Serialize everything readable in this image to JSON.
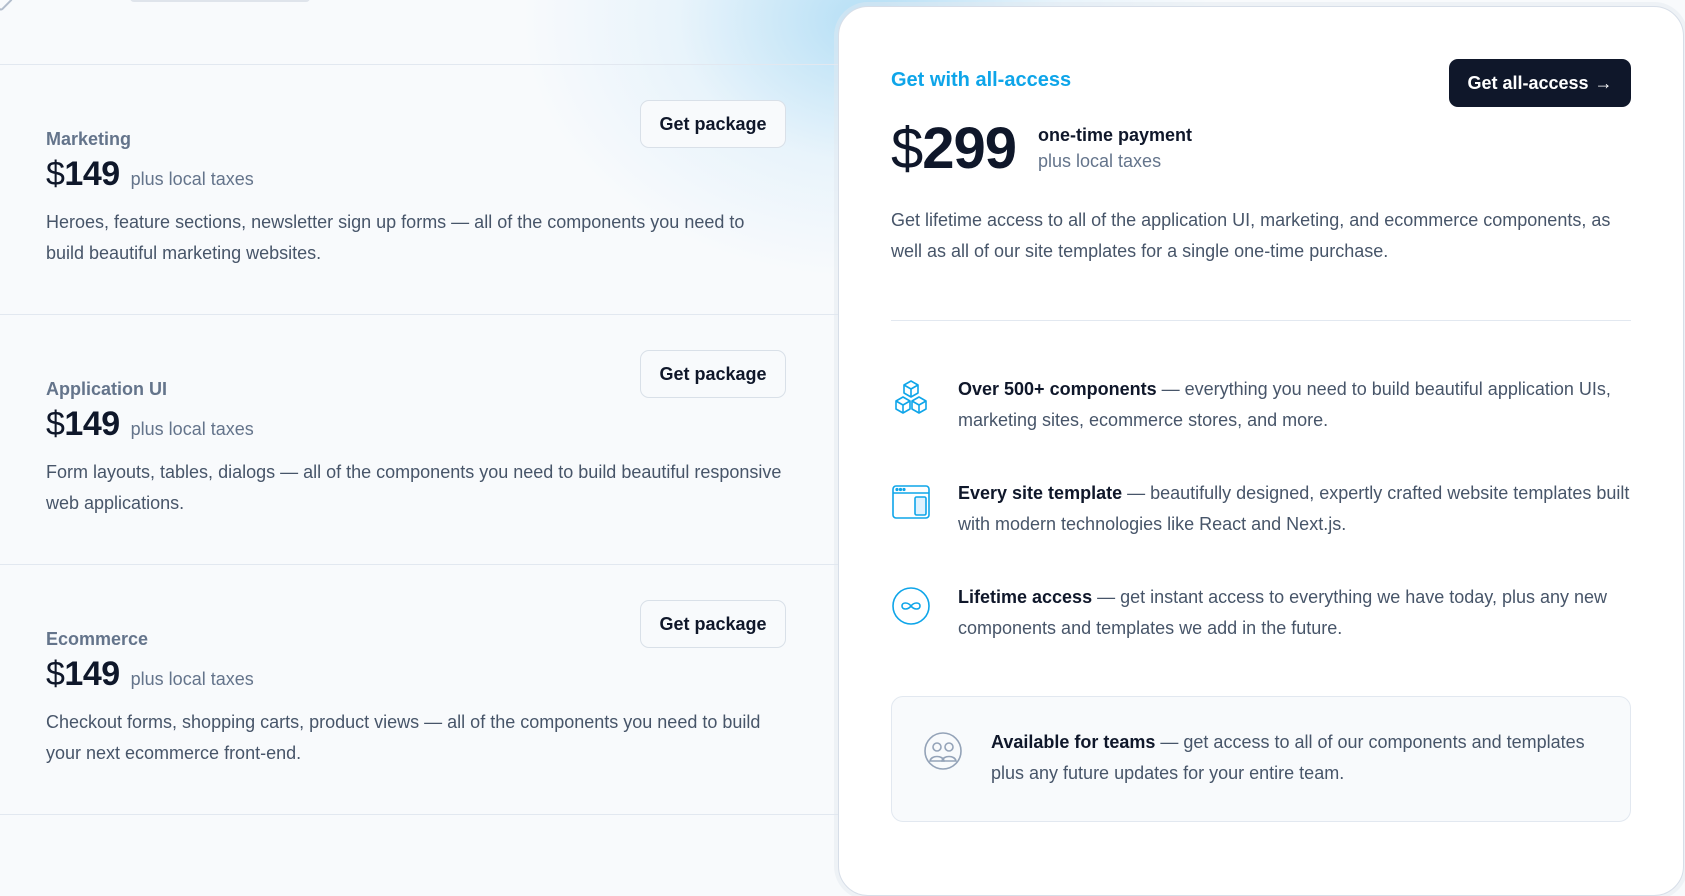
{
  "packages": [
    {
      "name": "Marketing",
      "currency": "$",
      "price": "149",
      "tax_note": "plus local taxes",
      "button": "Get package",
      "description": "Heroes, feature sections, newsletter sign up forms — all of the components you need to build beautiful marketing websites."
    },
    {
      "name": "Application UI",
      "currency": "$",
      "price": "149",
      "tax_note": "plus local taxes",
      "button": "Get package",
      "description": "Form layouts, tables, dialogs — all of the components you need to build beautiful responsive web applications."
    },
    {
      "name": "Ecommerce",
      "currency": "$",
      "price": "149",
      "tax_note": "plus local taxes",
      "button": "Get package",
      "description": "Checkout forms, shopping carts, product views — all of the components you need to build your next ecommerce front-end."
    }
  ],
  "all_access": {
    "eyebrow": "Get with all-access",
    "cta": "Get all-access",
    "cta_arrow": "→",
    "currency": "$",
    "price": "299",
    "payment_label": "one-time payment",
    "tax_note": "plus local taxes",
    "description": "Get lifetime access to all of the application UI, marketing, and ecommerce components, as well as all of our site templates for a single one-time purchase.",
    "features": [
      {
        "icon": "cubes-icon",
        "title": "Over 500+ components",
        "text": " — everything you need to build beautiful application UIs, marketing sites, ecommerce stores, and more."
      },
      {
        "icon": "browser-window-icon",
        "title": "Every site template",
        "text": " — beautifully designed, expertly crafted website templates built with modern technologies like React and Next.js."
      },
      {
        "icon": "infinity-icon",
        "title": "Lifetime access",
        "text": " — get instant access to everything we have today, plus any new components and templates we add in the future."
      }
    ],
    "teams": {
      "icon": "team-icon",
      "title": "Available for teams",
      "text": " — get access to all of our components and templates plus any future updates for your entire team."
    }
  },
  "colors": {
    "accent": "#0ea5e9",
    "dark": "#0f172a",
    "muted": "#64748b",
    "body": "#475569",
    "border": "#e2e8f0"
  }
}
